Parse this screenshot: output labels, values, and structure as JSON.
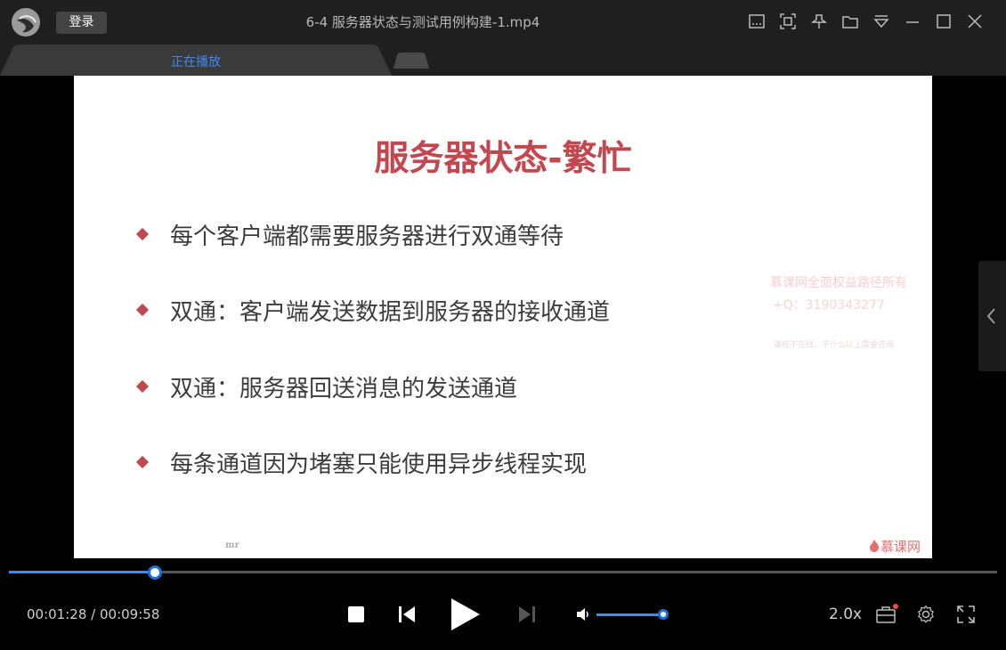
{
  "titlebar": {
    "login_label": "登录",
    "window_title": "6-4 服务器状态与测试用例构建-1.mp4",
    "icons": [
      "subtitle-icon",
      "screenshot-icon",
      "pin-icon",
      "folder-icon",
      "menu-icon",
      "minimize-icon",
      "maximize-icon",
      "close-icon"
    ]
  },
  "tabs": {
    "active_label": "正在播放"
  },
  "slide": {
    "title": "服务器状态-繁忙",
    "bullets": [
      "每个客户端都需要服务器进行双通等待",
      "双通：客户端发送数据到服务器的接收通道",
      "双通：服务器回送消息的发送通道",
      "每条通道因为堵塞只能使用异步线程实现"
    ],
    "watermark_line1": "慕课网全面权益路径所有",
    "watermark_line2": "+Q：3190343277",
    "watermark_line3": "课程不在线，不什么以上需要咨询",
    "footer_mark": "mr",
    "brand": "慕课网"
  },
  "player": {
    "current_time": "00:01:28",
    "separator": "/",
    "total_time": "00:09:58",
    "progress": 0.148,
    "volume": 1.0,
    "speed_label": "2.0x",
    "accent_color": "#3a8ef5"
  }
}
